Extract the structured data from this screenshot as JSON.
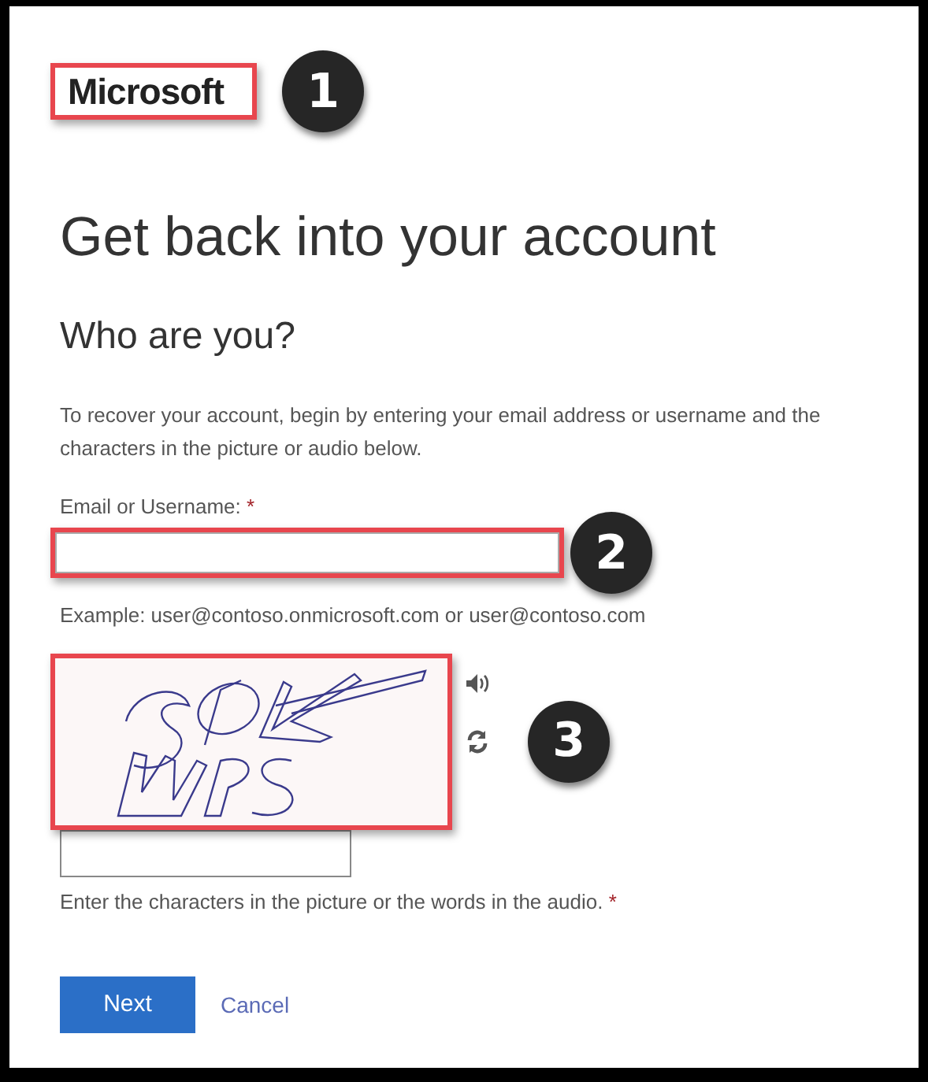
{
  "logo": {
    "text": "Microsoft",
    "highlighted": true,
    "callout": "1"
  },
  "title": "Get back into your account",
  "subtitle": "Who are you?",
  "instructions": "To recover your account, begin by entering your email address or username and the characters in the picture or audio below.",
  "email": {
    "label": "Email or Username:",
    "required_mark": "*",
    "highlighted": true,
    "callout": "2",
    "example": "Example: user@contoso.onmicrosoft.com or user@contoso.com"
  },
  "captcha": {
    "kind": "picture",
    "highlighted": true,
    "callout": "3",
    "hint": "Enter the characters in the picture or the words in the audio.",
    "required_mark": "*"
  },
  "buttons": {
    "next": "Next",
    "cancel": "Cancel"
  }
}
